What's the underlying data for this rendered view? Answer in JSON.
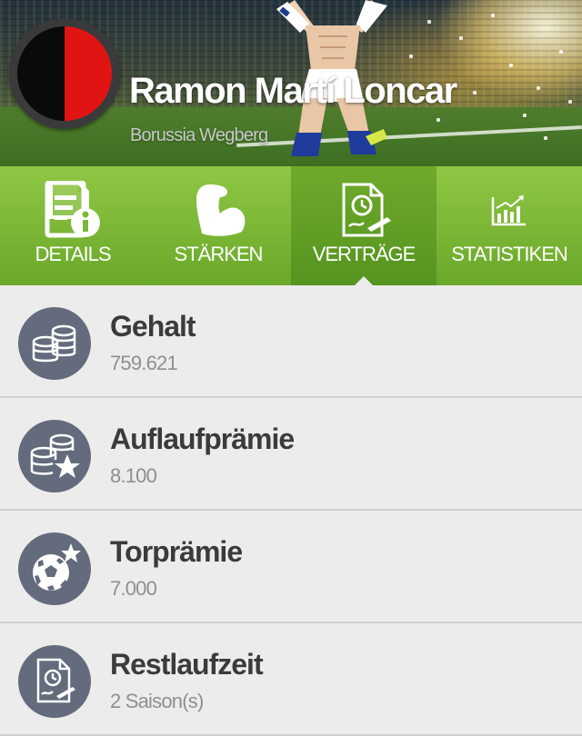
{
  "header": {
    "player_name": "Ramon Martí Loncar",
    "club_name": "Borussia Wegberg",
    "club_logo_colors": [
      "#0a0a0a",
      "#e11414"
    ]
  },
  "tabs": [
    {
      "label": "DETAILS",
      "icon": "details-info-icon",
      "active": false
    },
    {
      "label": "STÄRKEN",
      "icon": "flexed-arm-icon",
      "active": false
    },
    {
      "label": "VERTRÄGE",
      "icon": "contract-icon",
      "active": true
    },
    {
      "label": "STATISTIKEN",
      "icon": "bar-chart-icon",
      "active": false
    }
  ],
  "contract_items": [
    {
      "title": "Gehalt",
      "value": "759.621",
      "icon": "coins-icon"
    },
    {
      "title": "Auflaufprämie",
      "value": "8.100",
      "icon": "coins-star-icon"
    },
    {
      "title": "Torprämie",
      "value": "7.000",
      "icon": "soccer-ball-star-icon"
    },
    {
      "title": "Restlaufzeit",
      "value": "2 Saison(s)",
      "icon": "contract-clock-icon"
    }
  ],
  "colors": {
    "tab_green": "#7cb835",
    "tab_active_green": "#5f9e25",
    "icon_circle": "#636b7c",
    "background": "#ececec"
  }
}
